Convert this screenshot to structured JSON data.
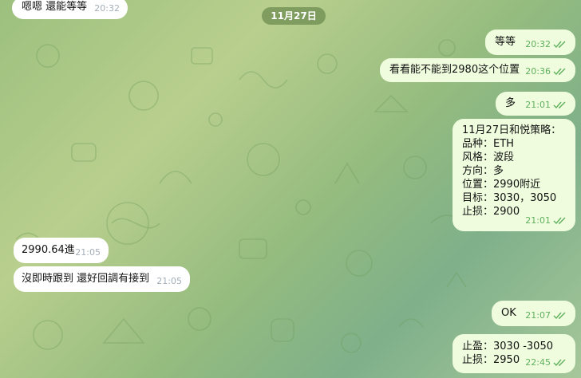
{
  "date_separator": "11月27日",
  "messages": [
    {
      "text": "嗯嗯 還能等等",
      "time": "20:32"
    },
    {
      "text": "等等",
      "time": "20:32"
    },
    {
      "text": "看看能不能到2980这个位置",
      "time": "20:36"
    },
    {
      "text": "多",
      "time": "21:01"
    },
    {
      "text": "11月27日和悦策略：\n品种：ETH\n风格：波段\n方向：多\n位置：2990附近\n目标：3030，3050\n止损：2900",
      "time": "21:01"
    },
    {
      "text": "2990.64進",
      "time": "21:05"
    },
    {
      "text": "沒即時跟到 還好回調有接到",
      "time": "21:05"
    },
    {
      "text": "OK",
      "time": "21:07"
    },
    {
      "text": "止盈：3030 -3050\n止损：2950",
      "time": "22:45"
    }
  ],
  "colors": {
    "incoming_bubble": "#ffffff",
    "outgoing_bubble": "#effdde",
    "read_check": "#5fb05e",
    "date_pill": "#618247"
  },
  "icons": {
    "read_receipt": "double-check-icon"
  }
}
